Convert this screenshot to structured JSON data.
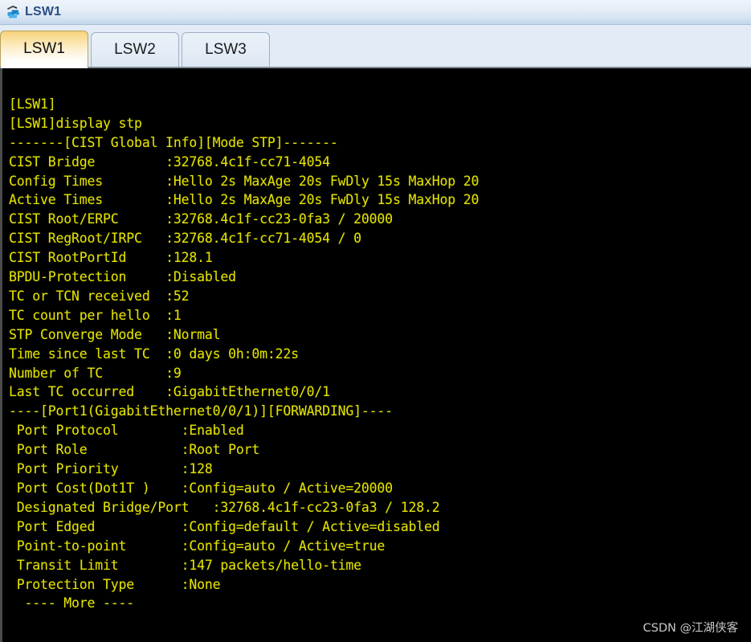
{
  "window": {
    "title": "LSW1",
    "icon": "network-switch-icon"
  },
  "tabs": [
    {
      "label": "LSW1",
      "active": true
    },
    {
      "label": "LSW2",
      "active": false
    },
    {
      "label": "LSW3",
      "active": false
    }
  ],
  "terminal": {
    "text_color": "#e2e200",
    "background_color": "#000000",
    "lines": [
      "",
      "[LSW1]",
      "[LSW1]display stp",
      "-------[CIST Global Info][Mode STP]-------",
      "CIST Bridge         :32768.4c1f-cc71-4054",
      "Config Times        :Hello 2s MaxAge 20s FwDly 15s MaxHop 20",
      "Active Times        :Hello 2s MaxAge 20s FwDly 15s MaxHop 20",
      "CIST Root/ERPC      :32768.4c1f-cc23-0fa3 / 20000",
      "CIST RegRoot/IRPC   :32768.4c1f-cc71-4054 / 0",
      "CIST RootPortId     :128.1",
      "BPDU-Protection     :Disabled",
      "TC or TCN received  :52",
      "TC count per hello  :1",
      "STP Converge Mode   :Normal",
      "Time since last TC  :0 days 0h:0m:22s",
      "Number of TC        :9",
      "Last TC occurred    :GigabitEthernet0/0/1",
      "----[Port1(GigabitEthernet0/0/1)][FORWARDING]----",
      " Port Protocol        :Enabled",
      " Port Role            :Root Port",
      " Port Priority        :128",
      " Port Cost(Dot1T )    :Config=auto / Active=20000",
      " Designated Bridge/Port   :32768.4c1f-cc23-0fa3 / 128.2",
      " Port Edged           :Config=default / Active=disabled",
      " Point-to-point       :Config=auto / Active=true",
      " Transit Limit        :147 packets/hello-time",
      " Protection Type      :None",
      "  ---- More ----"
    ]
  },
  "watermark": {
    "text": "CSDN @江湖侠客"
  }
}
